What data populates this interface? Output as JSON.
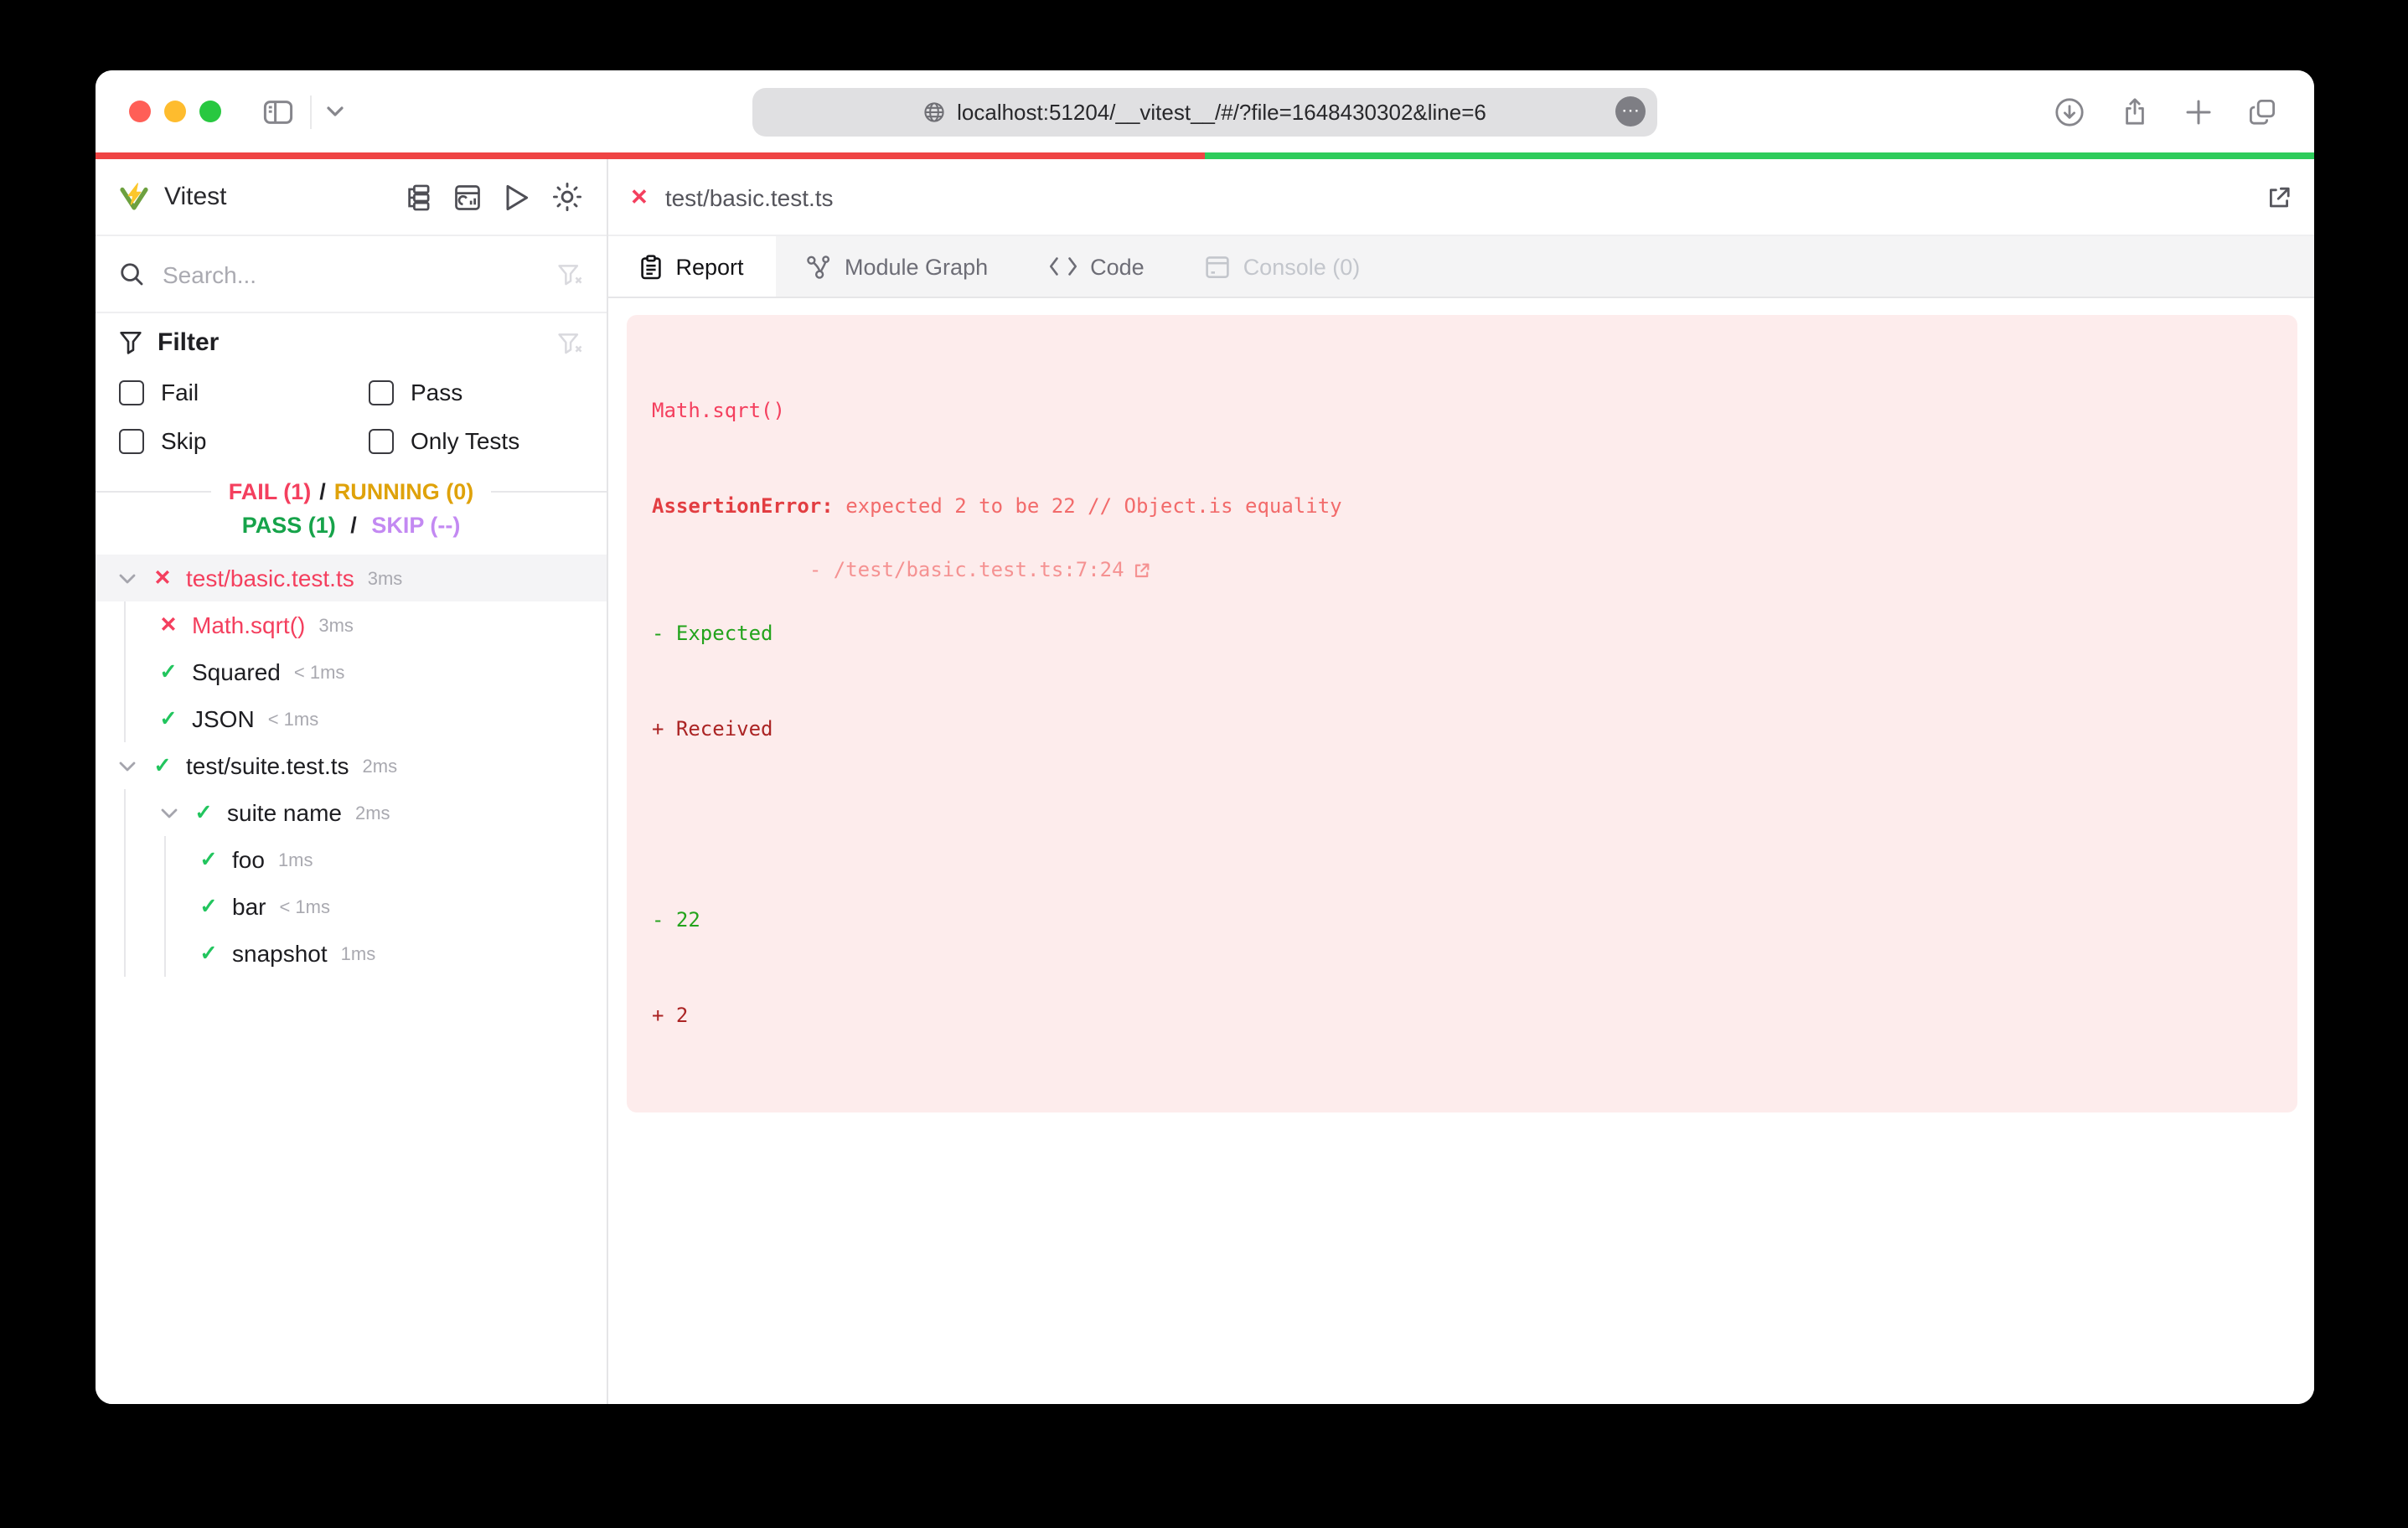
{
  "browser": {
    "url": "localhost:51204/__vitest__/#/?file=1648430302&line=6",
    "ellipsis_glyph": "⋯",
    "traffic_colors": {
      "close": "#ff5f57",
      "minimize": "#febc2e",
      "zoom": "#28c840"
    }
  },
  "progress": {
    "segments": [
      {
        "state": "fail",
        "color": "#ef4444",
        "percent": 50
      },
      {
        "state": "pass",
        "color": "#2ecc5b",
        "percent": 50
      }
    ]
  },
  "sidebar": {
    "app_title": "Vitest",
    "search_placeholder": "Search...",
    "filter": {
      "title": "Filter",
      "options": [
        {
          "label": "Fail",
          "checked": false
        },
        {
          "label": "Pass",
          "checked": false
        },
        {
          "label": "Skip",
          "checked": false
        },
        {
          "label": "Only Tests",
          "checked": false
        }
      ]
    },
    "summary": {
      "fail": "FAIL (1)",
      "running": "RUNNING (0)",
      "pass": "PASS (1)",
      "skip": "SKIP (--)",
      "separator": "/"
    },
    "tree": [
      {
        "label": "test/basic.test.ts",
        "duration": "3ms",
        "status": "fail",
        "level": 0,
        "expandable": true,
        "selected": true
      },
      {
        "label": "Math.sqrt()",
        "duration": "3ms",
        "status": "fail",
        "level": 1
      },
      {
        "label": "Squared",
        "duration": "< 1ms",
        "status": "pass",
        "level": 1
      },
      {
        "label": "JSON",
        "duration": "< 1ms",
        "status": "pass",
        "level": 1
      },
      {
        "label": "test/suite.test.ts",
        "duration": "2ms",
        "status": "pass",
        "level": 0,
        "expandable": true
      },
      {
        "label": "suite name",
        "duration": "2ms",
        "status": "pass",
        "level": 1,
        "expandable": true
      },
      {
        "label": "foo",
        "duration": "1ms",
        "status": "pass",
        "level": 2
      },
      {
        "label": "bar",
        "duration": "< 1ms",
        "status": "pass",
        "level": 2
      },
      {
        "label": "snapshot",
        "duration": "1ms",
        "status": "pass",
        "level": 2
      }
    ]
  },
  "main": {
    "file_tab": "test/basic.test.ts",
    "tabs": [
      {
        "label": "Report",
        "active": true
      },
      {
        "label": "Module Graph"
      },
      {
        "label": "Code"
      },
      {
        "label": "Console (0)",
        "disabled": true
      }
    ],
    "report": {
      "title": "Math.sqrt()",
      "error_name": "AssertionError: ",
      "error_message": "expected 2 to be 22 // Object.is equality",
      "location": " - /test/basic.test.ts:7:24",
      "diff_expected": "- Expected",
      "diff_received": "+ Received",
      "diff_removed": "- 22",
      "diff_added": "+ 2",
      "panel_bg": "#fdecec"
    }
  },
  "icons": {
    "fail_glyph": "✕",
    "pass_glyph": "✓"
  }
}
